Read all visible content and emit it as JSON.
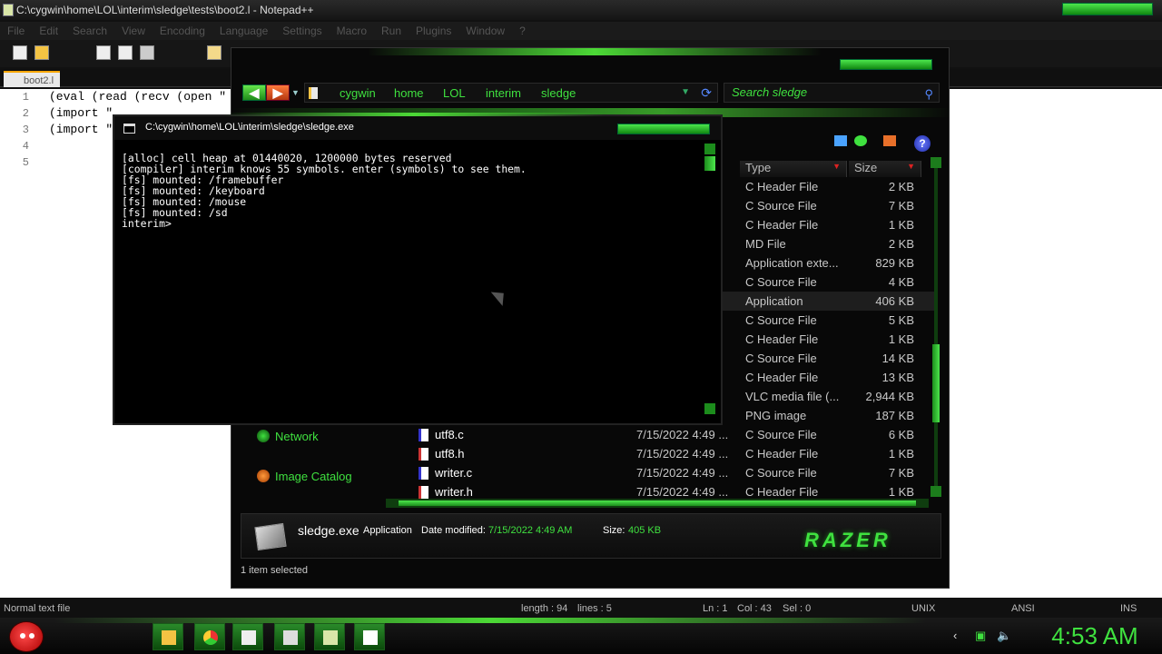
{
  "notepad": {
    "title": "C:\\cygwin\\home\\LOL\\interim\\sledge\\tests\\boot2.l - Notepad++",
    "menu": [
      "File",
      "Edit",
      "Search",
      "View",
      "Encoding",
      "Language",
      "Settings",
      "Macro",
      "Run",
      "Plugins",
      "Window",
      "?"
    ],
    "tab_label": "boot2.l",
    "line_numbers": [
      "1",
      "2",
      "3",
      "4",
      "5"
    ],
    "lines": [
      "(eval (read (recv (open \"",
      "(import \"",
      "(import \"",
      "",
      ""
    ],
    "status": {
      "file_type": "Normal text file",
      "length": "length : 94",
      "lines": "lines : 5",
      "ln": "Ln : 1",
      "col": "Col : 43",
      "sel": "Sel : 0",
      "eol": "UNIX",
      "encoding": "ANSI",
      "mode": "INS"
    }
  },
  "explorer": {
    "breadcrumb": [
      "cygwin",
      "home",
      "LOL",
      "interim",
      "sledge"
    ],
    "search_placeholder": "Search sledge",
    "columns": {
      "type": "Type",
      "size": "Size"
    },
    "nav": [
      {
        "label": "Network"
      },
      {
        "label": "Image Catalog"
      }
    ],
    "rows": [
      {
        "name": "",
        "date": "",
        "type": "C Header File",
        "size": "2 KB"
      },
      {
        "name": "",
        "date": "",
        "type": "C Source File",
        "size": "7 KB"
      },
      {
        "name": "",
        "date": "",
        "type": "C Header File",
        "size": "1 KB"
      },
      {
        "name": "",
        "date": "",
        "type": "MD File",
        "size": "2 KB"
      },
      {
        "name": "",
        "date": "",
        "type": "Application exte...",
        "size": "829 KB"
      },
      {
        "name": "",
        "date": "",
        "type": "C Source File",
        "size": "4 KB"
      },
      {
        "name": "",
        "date": "",
        "type": "Application",
        "size": "406 KB",
        "selected": true
      },
      {
        "name": "",
        "date": "",
        "type": "C Source File",
        "size": "5 KB"
      },
      {
        "name": "",
        "date": "",
        "type": "C Header File",
        "size": "1 KB"
      },
      {
        "name": "",
        "date": "",
        "type": "C Source File",
        "size": "14 KB"
      },
      {
        "name": "",
        "date": "",
        "type": "C Header File",
        "size": "13 KB"
      },
      {
        "name": "",
        "date": "",
        "type": "VLC media file (...",
        "size": "2,944 KB"
      },
      {
        "name": "",
        "date": "",
        "type": "PNG image",
        "size": "187 KB"
      },
      {
        "name": "utf8.c",
        "date": "7/15/2022 4:49 ...",
        "type": "C Source File",
        "size": "6 KB"
      },
      {
        "name": "utf8.h",
        "date": "7/15/2022 4:49 ...",
        "type": "C Header File",
        "size": "1 KB"
      },
      {
        "name": "writer.c",
        "date": "7/15/2022 4:49 ...",
        "type": "C Source File",
        "size": "7 KB"
      },
      {
        "name": "writer.h",
        "date": "7/15/2022 4:49 ...",
        "type": "C Header File",
        "size": "1 KB"
      }
    ],
    "details": {
      "file_name": "sledge.exe",
      "file_type": "Application",
      "date_label": "Date modified:",
      "date_value": "7/15/2022 4:49 AM",
      "size_label": "Size:",
      "size_value": "405 KB",
      "brand": "RAZER"
    },
    "status": "1 item selected"
  },
  "console": {
    "title": "C:\\cygwin\\home\\LOL\\interim\\sledge\\sledge.exe",
    "lines": [
      "[alloc] cell heap at 01440020, 1200000 bytes reserved",
      "[compiler] interim knows 55 symbols. enter (symbols) to see them.",
      "[fs] mounted: /framebuffer",
      "[fs] mounted: /keyboard",
      "[fs] mounted: /mouse",
      "[fs] mounted: /sd",
      "interim>"
    ]
  },
  "taskbar": {
    "clock": "4:53 AM",
    "colors": {
      "accent": "#3fe13f",
      "accent_dark": "#1c8c1c"
    }
  }
}
